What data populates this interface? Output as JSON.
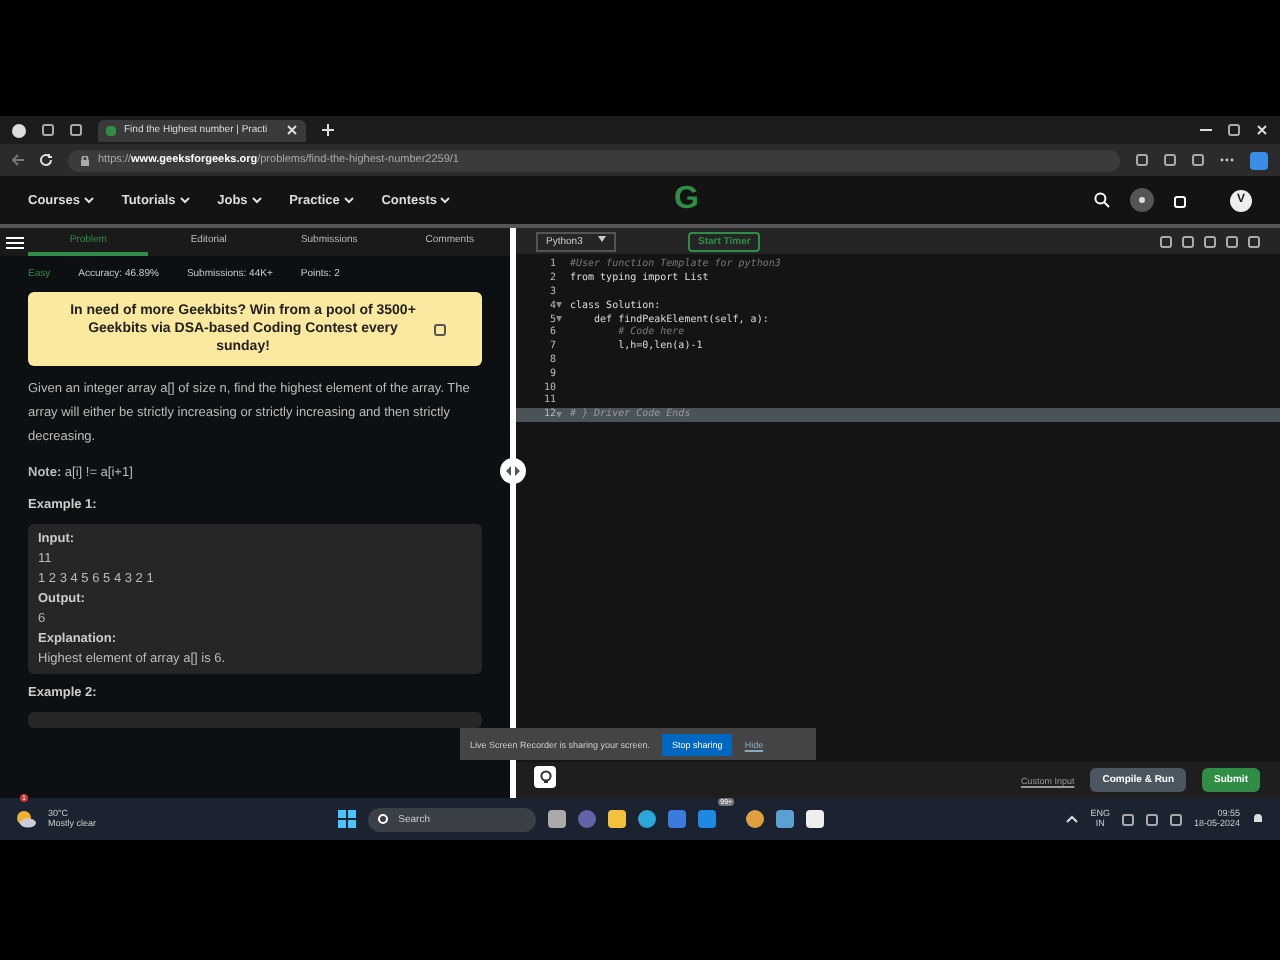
{
  "browser": {
    "tab_title": "Find the Highest number | Practi",
    "url_prefix": "https://",
    "url_domain": "www.geeksforgeeks.org",
    "url_path": "/problems/find-the-highest-number2259/1"
  },
  "nav": {
    "items": [
      {
        "label": "Courses"
      },
      {
        "label": "Tutorials"
      },
      {
        "label": "Jobs"
      },
      {
        "label": "Practice"
      },
      {
        "label": "Contests"
      }
    ],
    "logo": "G",
    "avatar": "V"
  },
  "problem_tabs": [
    {
      "label": "Problem",
      "selected": true
    },
    {
      "label": "Editorial",
      "selected": false
    },
    {
      "label": "Submissions",
      "selected": false
    },
    {
      "label": "Comments",
      "selected": false
    }
  ],
  "meta": {
    "difficulty": "Easy",
    "accuracy": "Accuracy: 46.89%",
    "submissions": "Submissions: 44K+",
    "points": "Points: 2"
  },
  "banner": "In need of more Geekbits? Win from a pool of 3500+ Geekbits via DSA-based Coding Contest every sunday!",
  "description": "Given an integer array a[] of size n, find the highest element of the array. The array will either be strictly increasing or strictly increasing and then strictly decreasing.",
  "note": "**Note:** a[i] != a[i+1]",
  "example1": {
    "title": "Example 1:",
    "lines": [
      {
        "text": "Input:",
        "kind": "label"
      },
      {
        "text": "11",
        "kind": "value"
      },
      {
        "text": "1 2 3 4 5 6 5 4 3 2 1",
        "kind": "value"
      },
      {
        "text": "Output:",
        "kind": "label"
      },
      {
        "text": "6",
        "kind": "value"
      },
      {
        "text": "Explanation:",
        "kind": "label"
      },
      {
        "text": "Highest element of array a[] is 6.",
        "kind": "value"
      }
    ]
  },
  "example2": {
    "title": "Example 2:"
  },
  "editor": {
    "language": "Python3",
    "timer": "Start Timer",
    "lines": [
      {
        "n": "1",
        "text": "#User function Template for python3",
        "kind": "comment",
        "foldable": false
      },
      {
        "n": "2",
        "text": "from typing import List",
        "kind": "code",
        "foldable": false
      },
      {
        "n": "3",
        "kind": "code",
        "foldable": false
      },
      {
        "n": "4",
        "text": "class Solution:",
        "kind": "code",
        "foldable": true
      },
      {
        "n": "5",
        "text": "    def findPeakElement(self, a):",
        "kind": "code",
        "foldable": true
      },
      {
        "n": "6",
        "text": "        # Code here",
        "kind": "comment",
        "foldable": false
      },
      {
        "n": "7",
        "text": "        l,h=0,len(a)-1",
        "kind": "code",
        "foldable": false
      },
      {
        "n": "8",
        "kind": "code",
        "foldable": false
      },
      {
        "n": "9",
        "kind": "code",
        "foldable": false
      },
      {
        "n": "10",
        "kind": "code",
        "foldable": false
      },
      {
        "n": "11",
        "kind": "code",
        "foldable": false
      },
      {
        "n": "12",
        "text": "# } Driver Code Ends",
        "kind": "folded",
        "foldable": true
      }
    ]
  },
  "footer": {
    "custom_input": "Custom Input",
    "compile": "Compile & Run",
    "submit": "Submit"
  },
  "share_bar": {
    "message": "Live Screen Recorder is sharing your screen.",
    "stop": "Stop sharing",
    "hide": "Hide"
  },
  "taskbar": {
    "temperature": "30°C",
    "weather": "Mostly clear",
    "weather_badge": "1",
    "search": "Search",
    "mail_badge": "99+",
    "lang_top": "ENG",
    "lang_bottom": "IN",
    "time": "09:55",
    "date": "18-05-2024"
  }
}
